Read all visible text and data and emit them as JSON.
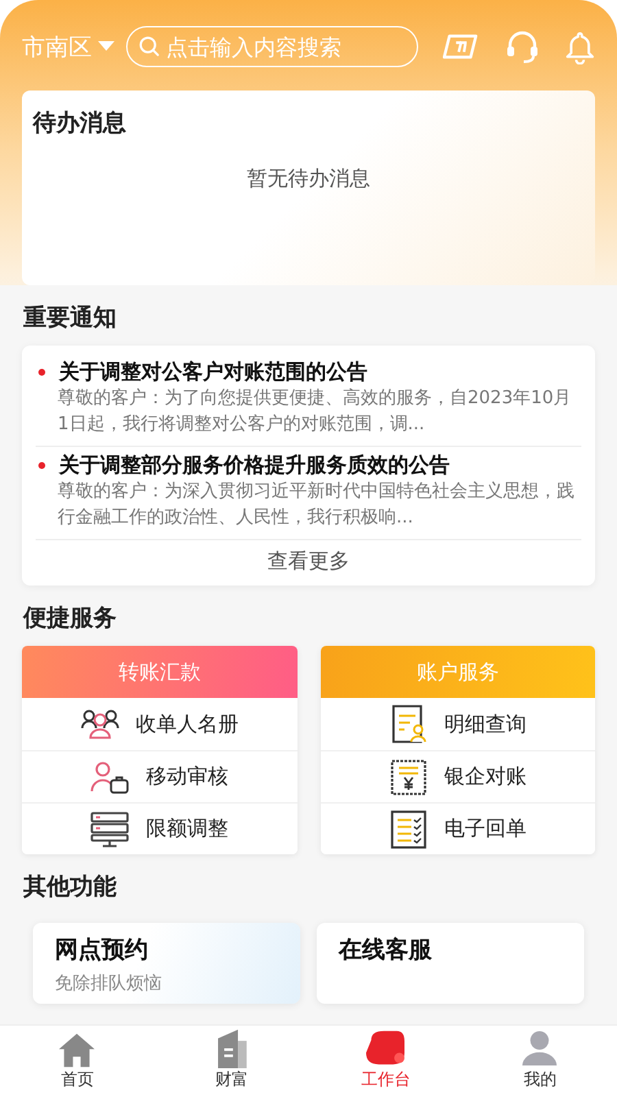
{
  "header": {
    "location": "市南区",
    "search": {
      "placeholder": "点击输入内容搜索"
    }
  },
  "todo": {
    "title": "待办消息",
    "empty_text": "暂无待办消息"
  },
  "notices": {
    "title": "重要通知",
    "items": [
      {
        "title": "关于调整对公客户对账范围的公告",
        "summary": "尊敬的客户：为了向您提供更便捷、高效的服务，自2023年10月1日起，我行将调整对公客户的对账范围，调..."
      },
      {
        "title": "关于调整部分服务价格提升服务质效的公告",
        "summary": "尊敬的客户：为深入贯彻习近平新时代中国特色社会主义思想，践行金融工作的政治性、人民性，我行积极响..."
      }
    ],
    "more": "查看更多"
  },
  "quick": {
    "title": "便捷服务",
    "groups": [
      {
        "title": "转账汇款",
        "kind": "transfer",
        "items": [
          {
            "label": "收单人名册",
            "kind": "people"
          },
          {
            "label": "移动审核",
            "kind": "approve"
          },
          {
            "label": "限额调整",
            "kind": "server"
          }
        ]
      },
      {
        "title": "账户服务",
        "kind": "account",
        "items": [
          {
            "label": "明细查询",
            "kind": "detail"
          },
          {
            "label": "银企对账",
            "kind": "yen"
          },
          {
            "label": "电子回单",
            "kind": "list"
          }
        ]
      }
    ]
  },
  "other": {
    "title": "其他功能",
    "cards": [
      {
        "title": "网点预约",
        "subtitle": "免除排队烦恼"
      },
      {
        "title": "在线客服"
      }
    ]
  },
  "tabs": [
    {
      "label": "首页",
      "kind": "home",
      "selected": false
    },
    {
      "label": "财富",
      "kind": "wealth",
      "selected": false
    },
    {
      "label": "工作台",
      "kind": "work",
      "selected": true
    },
    {
      "label": "我的",
      "kind": "me",
      "selected": false
    }
  ]
}
